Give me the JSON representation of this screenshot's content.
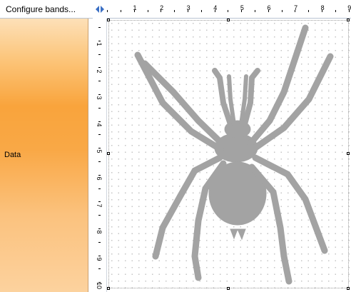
{
  "band_panel": {
    "configure_label": "Configure bands...",
    "band_name": "Data"
  },
  "ruler": {
    "top_numbers": [
      "1",
      "2",
      "3",
      "4",
      "5",
      "6",
      "7",
      "8",
      "9"
    ],
    "left_numbers": [
      "1",
      "2",
      "3",
      "4",
      "5",
      "6",
      "7",
      "8",
      "9",
      "10"
    ]
  },
  "picture": {
    "subject": "tarantula-illustration",
    "fill_color": "#a3a3a3"
  },
  "colors": {
    "band_gradient_top": "#fde0b8",
    "band_gradient_mid": "#f9a43c",
    "band_gradient_bottom": "#fcd29e",
    "toggle_arrow": "#3a6fc4"
  }
}
